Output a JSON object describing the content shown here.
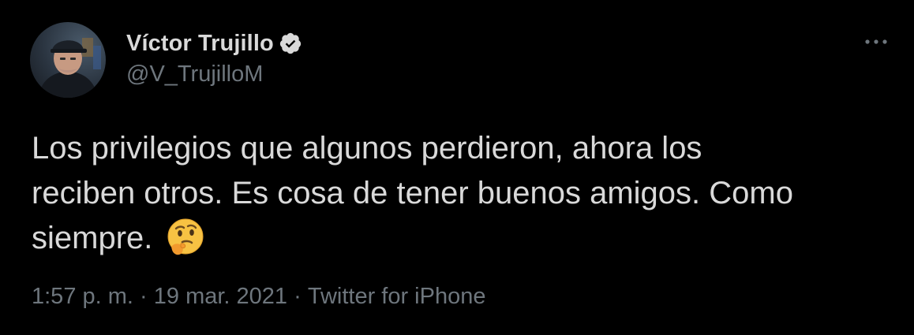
{
  "tweet": {
    "author": {
      "display_name": "Víctor Trujillo",
      "handle": "@V_TrujilloM",
      "verified_icon": "verified-badge-icon",
      "avatar_icon": "avatar"
    },
    "more_icon": "more-options-icon",
    "text_line1": "Los privilegios que algunos perdieron, ahora los",
    "text_line2": "reciben otros. Es cosa de tener buenos amigos. Como",
    "text_line3": "siempre.",
    "emoji_icon": "thinking-face-emoji",
    "meta": {
      "time": "1:57 p. m.",
      "separator": " · ",
      "date": "19 mar. 2021",
      "source": "Twitter for iPhone"
    }
  },
  "colors": {
    "background": "#000000",
    "primary_text": "#d9d9d9",
    "secondary_text": "#6e767d"
  }
}
